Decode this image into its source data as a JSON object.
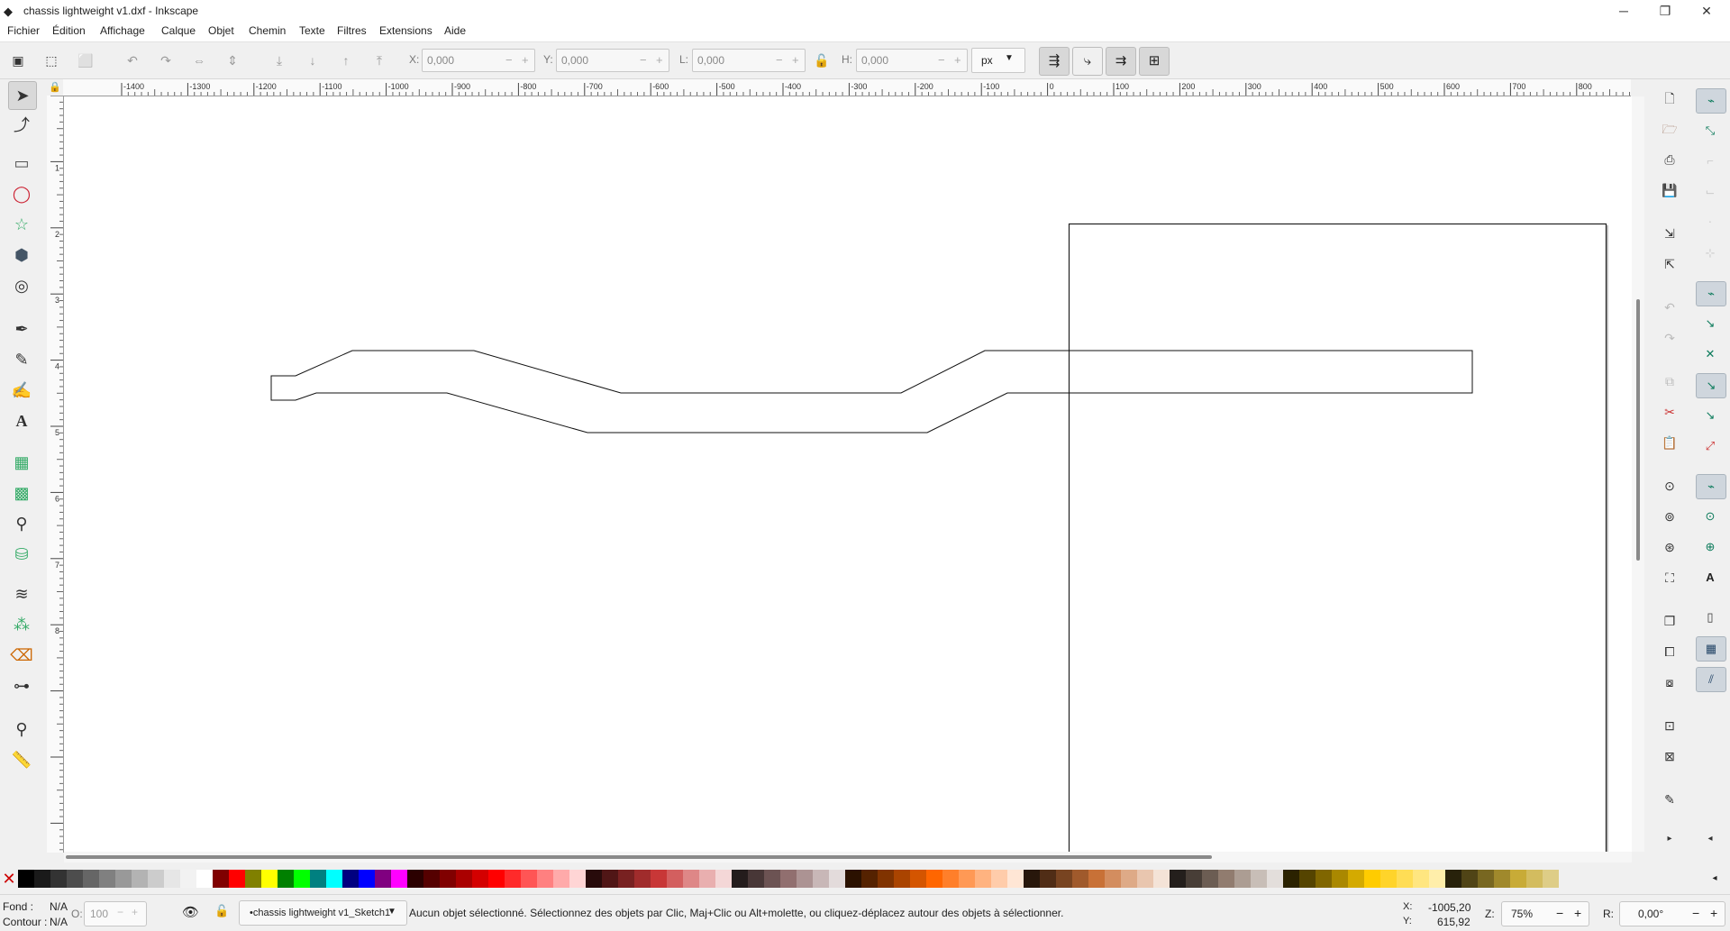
{
  "window": {
    "title": "chassis lightweight v1.dxf - Inkscape",
    "controls": [
      "─",
      "❐",
      "✕"
    ]
  },
  "menu": [
    "Fichier",
    "Édition",
    "Affichage",
    "Calque",
    "Objet",
    "Chemin",
    "Texte",
    "Filtres",
    "Extensions",
    "Aide"
  ],
  "toolbar": {
    "x_label": "X:",
    "x_value": "0,000",
    "y_label": "Y:",
    "y_value": "0,000",
    "w_label": "L:",
    "w_value": "0,000",
    "h_label": "H:",
    "h_value": "0,000",
    "unit": "px",
    "minus": "−",
    "plus": "+"
  },
  "ruler_top_labels": [
    "-1400",
    "-1300",
    "-1200",
    "-1100",
    "-1000",
    "-900",
    "-800",
    "-700",
    "-600",
    "-500",
    "-400",
    "-300",
    "-200",
    "-100",
    "0",
    "100",
    "200",
    "300",
    "400",
    "500",
    "600",
    "700",
    "800"
  ],
  "ruler_left_labels": [
    "1",
    "2",
    "3",
    "4",
    "5",
    "6",
    "7",
    "8"
  ],
  "tools": [
    {
      "name": "selector-tool",
      "glyph": "➤",
      "selected": true
    },
    {
      "name": "node-tool",
      "glyph": "⤴"
    },
    {
      "name": "rectangle-tool",
      "glyph": "▭"
    },
    {
      "name": "ellipse-tool",
      "glyph": "◯"
    },
    {
      "name": "star-tool",
      "glyph": "☆"
    },
    {
      "name": "3dbox-tool",
      "glyph": "⬢"
    },
    {
      "name": "spiral-tool",
      "glyph": "◎"
    },
    {
      "name": "bezier-tool",
      "glyph": "✒"
    },
    {
      "name": "pencil-tool",
      "glyph": "✎"
    },
    {
      "name": "calligraphy-tool",
      "glyph": "✍"
    },
    {
      "name": "text-tool",
      "glyph": "A"
    },
    {
      "name": "gradient-tool",
      "glyph": "▦"
    },
    {
      "name": "mesh-tool",
      "glyph": "▩"
    },
    {
      "name": "dropper-tool",
      "glyph": "⚲"
    },
    {
      "name": "paint-bucket-tool",
      "glyph": "⛁"
    },
    {
      "name": "tweak-tool",
      "glyph": "≋"
    },
    {
      "name": "spray-tool",
      "glyph": "⁂"
    },
    {
      "name": "eraser-tool",
      "glyph": "⌫"
    },
    {
      "name": "connector-tool",
      "glyph": "⊶"
    },
    {
      "name": "zoom-tool",
      "glyph": "⚲"
    },
    {
      "name": "measure-tool",
      "glyph": "📏"
    }
  ],
  "status": {
    "fill_label": "Fond :",
    "fill_value": "N/A",
    "stroke_label": "Contour :",
    "stroke_value": "N/A",
    "opacity_label": "O:",
    "opacity_value": "100",
    "layer": "•chassis lightweight v1_Sketch1",
    "message": "Aucun objet sélectionné. Sélectionnez des objets par Clic, Maj+Clic ou Alt+molette, ou cliquez-déplacez autour des objets à sélectionner.",
    "cursor_x_label": "X:",
    "cursor_x": "-1005,20",
    "cursor_y_label": "Y:",
    "cursor_y": "615,92",
    "zoom_label": "Z:",
    "zoom": "75%",
    "rotation_label": "R:",
    "rotation": "0,00°"
  },
  "palette_colors": [
    "#000000",
    "#1a1a1a",
    "#333333",
    "#4d4d4d",
    "#666666",
    "#808080",
    "#999999",
    "#b3b3b3",
    "#cccccc",
    "#e6e6e6",
    "#f2f2f2",
    "#ffffff",
    "#800000",
    "#ff0000",
    "#808000",
    "#ffff00",
    "#008000",
    "#00ff00",
    "#008080",
    "#00ffff",
    "#000080",
    "#0000ff",
    "#800080",
    "#ff00ff",
    "#2b0000",
    "#550000",
    "#800000",
    "#aa0000",
    "#d40000",
    "#ff0000",
    "#ff2a2a",
    "#ff5555",
    "#ff8080",
    "#ffaaaa",
    "#ffd5d5",
    "#280b0b",
    "#501616",
    "#782121",
    "#a02c2c",
    "#c83737",
    "#d35f5f",
    "#de8787",
    "#e9afaf",
    "#f4d7d7",
    "#241c1c",
    "#483737",
    "#6c5353",
    "#916f6f",
    "#ac9393",
    "#c8b7b7",
    "#e3dbdb",
    "#2b1100",
    "#552200",
    "#803300",
    "#aa4400",
    "#d45500",
    "#ff6600",
    "#ff7f2a",
    "#ff9955",
    "#ffb380",
    "#ffccaa",
    "#ffe6d5",
    "#28170b",
    "#502d16",
    "#784421",
    "#a05a2c",
    "#c87137",
    "#d38d5f",
    "#deaa87",
    "#e9c6af",
    "#f4e3d7",
    "#241f1c",
    "#483e37",
    "#6c5d53",
    "#917c6f",
    "#ac9d93",
    "#c8beb7",
    "#e3dedb",
    "#2b2200",
    "#554400",
    "#806600",
    "#aa8800",
    "#d4aa00",
    "#ffcc00",
    "#ffd42a",
    "#ffdd55",
    "#ffe680",
    "#ffeeaa",
    "#28220b",
    "#504416",
    "#786721",
    "#a0892c",
    "#c8ab37",
    "#d3bc5f",
    "#decd87"
  ]
}
